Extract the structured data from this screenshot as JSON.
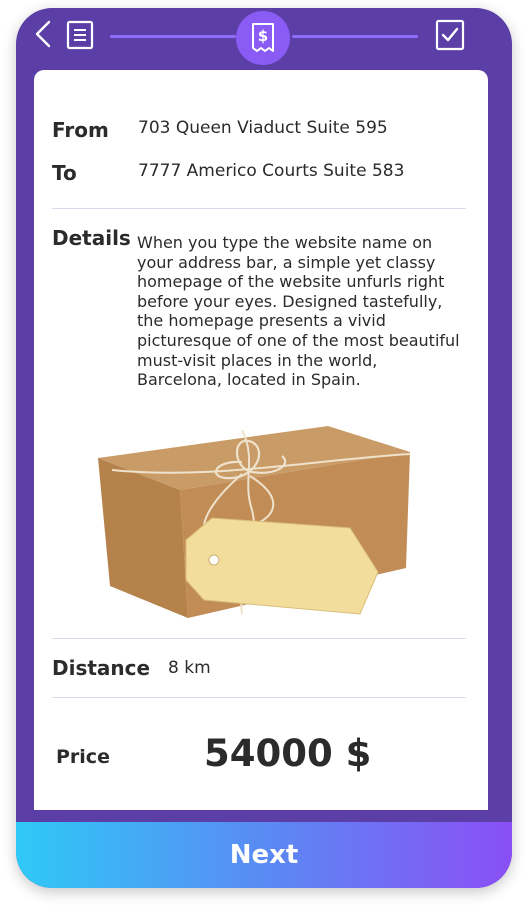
{
  "colors": {
    "frame": "#5b3fa6",
    "accent": "#6a4ef0",
    "step_active": "#8a5cf5",
    "next_gradient_start": "#2ec9f6",
    "next_gradient_end": "#8a4ff5"
  },
  "stepper": {
    "back_icon": "chevron-left-icon",
    "steps": [
      {
        "icon": "list-document-icon",
        "state": "done"
      },
      {
        "icon": "dollar-receipt-icon",
        "state": "active"
      },
      {
        "icon": "checked-clipboard-icon",
        "state": "pending"
      }
    ]
  },
  "route": {
    "from_label": "From",
    "from_value": "703 Queen Viaduct Suite 595",
    "to_label": "To",
    "to_value": "7777 Americo Courts Suite 583"
  },
  "details": {
    "label": "Details",
    "text": "When you type the website name on your address bar, a simple yet classy homepage of the website unfurls right before your eyes. Designed tastefully, the homepage presents a vivid picturesque of one of the most beautiful must-visit places in the world, Barcelona, located in Spain.",
    "image": "parcel-with-tag-image"
  },
  "distance": {
    "label": "Distance",
    "value": "8 km"
  },
  "price": {
    "label": "Price",
    "value": "54000 $"
  },
  "next_label": "Next"
}
